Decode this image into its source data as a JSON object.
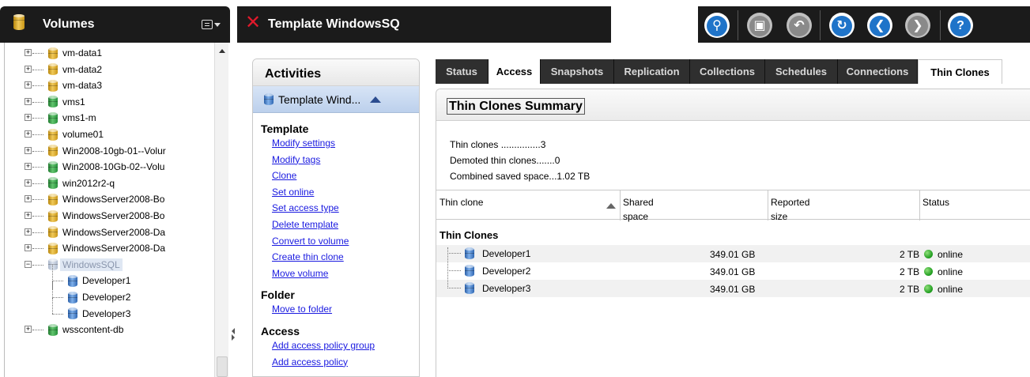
{
  "left_panel": {
    "title": "Volumes",
    "tree": [
      {
        "label": "vm-data1",
        "icon": "gold"
      },
      {
        "label": "vm-data2",
        "icon": "gold"
      },
      {
        "label": "vm-data3",
        "icon": "gold"
      },
      {
        "label": "vms1",
        "icon": "green"
      },
      {
        "label": "vms1-m",
        "icon": "green"
      },
      {
        "label": "volume01",
        "icon": "gold"
      },
      {
        "label": "Win2008-10gb-01--Volur",
        "icon": "gold"
      },
      {
        "label": "Win2008-10Gb-02--Volu",
        "icon": "green"
      },
      {
        "label": "win2012r2-q",
        "icon": "green"
      },
      {
        "label": "WindowsServer2008-Bo",
        "icon": "gold"
      },
      {
        "label": "WindowsServer2008-Bo",
        "icon": "gold"
      },
      {
        "label": "WindowsServer2008-Da",
        "icon": "gold"
      },
      {
        "label": "WindowsServer2008-Da",
        "icon": "gold"
      },
      {
        "label": "WindowsSQL",
        "icon": "grey"
      },
      {
        "label": "Developer1",
        "icon": "blue"
      },
      {
        "label": "Developer2",
        "icon": "blue"
      },
      {
        "label": "Developer3",
        "icon": "blue"
      },
      {
        "label": "wsscontent-db",
        "icon": "green"
      }
    ]
  },
  "main_header": {
    "title": "Template WindowsSQ"
  },
  "toolbar": {
    "buttons": [
      "search-icon",
      "save-icon",
      "undo-icon",
      "refresh-icon",
      "back-icon",
      "forward-icon",
      "help-icon"
    ],
    "labels": {
      "search": "⚲",
      "refresh": "C",
      "help": "?"
    }
  },
  "activities": {
    "title": "Activities",
    "subheader": "Template Wind...",
    "sections": [
      {
        "name": "Template",
        "links": [
          "Modify settings",
          "Modify tags",
          "Clone",
          "Set online",
          "Set access type",
          "Delete template",
          "Convert to volume",
          "Create thin clone",
          "Move volume"
        ]
      },
      {
        "name": "Folder",
        "links": [
          "Move to folder"
        ]
      },
      {
        "name": "Access",
        "links": [
          "Add access policy group",
          "Add access policy"
        ]
      }
    ]
  },
  "tabs": [
    "Status",
    "Access",
    "Snapshots",
    "Replication",
    "Collections",
    "Schedules",
    "Connections",
    "Thin Clones"
  ],
  "active_tab": "Thin Clones",
  "summary": {
    "title": "Thin Clones Summary",
    "stats": [
      "Thin clones ...............3",
      "Demoted thin clones.......0",
      "Combined saved space...1.02 TB"
    ]
  },
  "grid": {
    "columns": {
      "thin_clone": "Thin clone",
      "shared_1": "Shared",
      "shared_2": "space",
      "reported_1": "Reported",
      "reported_2": "size",
      "status": "Status"
    },
    "group": "Thin Clones",
    "rows": [
      {
        "name": "Developer1",
        "shared": "349.01 GB",
        "reported": "2 TB",
        "status": "online"
      },
      {
        "name": "Developer2",
        "shared": "349.01 GB",
        "reported": "2 TB",
        "status": "online"
      },
      {
        "name": "Developer3",
        "shared": "349.01 GB",
        "reported": "2 TB",
        "status": "online"
      }
    ]
  },
  "colors": {
    "header_bg": "#1b1b1b",
    "link": "#1a1ae0",
    "online": "#1c9a1c",
    "close_x": "#e0192b",
    "toolbar_blue": "#1f74c9"
  }
}
